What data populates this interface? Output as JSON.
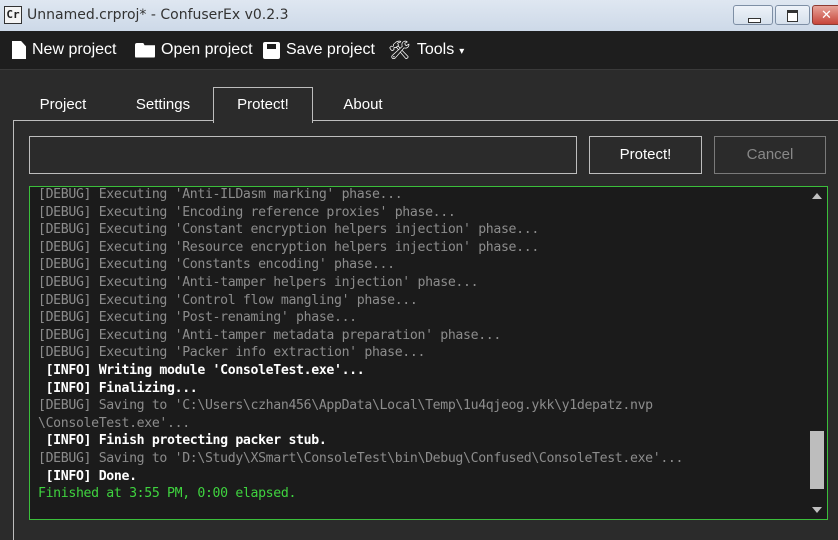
{
  "window": {
    "title": "Unnamed.crproj* - ConfuserEx v0.2.3",
    "icon_glyph": "Cr"
  },
  "toolbar": {
    "new_project": "New project",
    "open_project": "Open project",
    "save_project": "Save project",
    "tools": "Tools",
    "tools_caret": "▾"
  },
  "tabs": [
    {
      "label": "Project",
      "active": false
    },
    {
      "label": "Settings",
      "active": false
    },
    {
      "label": "Protect!",
      "active": true
    },
    {
      "label": "About",
      "active": false
    }
  ],
  "protect": {
    "input_value": "",
    "protect_button": "Protect!",
    "cancel_button": "Cancel",
    "cancel_enabled": false
  },
  "log": {
    "scroll_position": 0.95,
    "lines": [
      {
        "level": "debug",
        "text": "[DEBUG] Executing 'Anti-ILDasm marking' phase..."
      },
      {
        "level": "debug",
        "text": "[DEBUG] Executing 'Encoding reference proxies' phase..."
      },
      {
        "level": "debug",
        "text": "[DEBUG] Executing 'Constant encryption helpers injection' phase..."
      },
      {
        "level": "debug",
        "text": "[DEBUG] Executing 'Resource encryption helpers injection' phase..."
      },
      {
        "level": "debug",
        "text": "[DEBUG] Executing 'Constants encoding' phase..."
      },
      {
        "level": "debug",
        "text": "[DEBUG] Executing 'Anti-tamper helpers injection' phase..."
      },
      {
        "level": "debug",
        "text": "[DEBUG] Executing 'Control flow mangling' phase..."
      },
      {
        "level": "debug",
        "text": "[DEBUG] Executing 'Post-renaming' phase..."
      },
      {
        "level": "debug",
        "text": "[DEBUG] Executing 'Anti-tamper metadata preparation' phase..."
      },
      {
        "level": "debug",
        "text": "[DEBUG] Executing 'Packer info extraction' phase..."
      },
      {
        "level": "info",
        "text": " [INFO] Writing module 'ConsoleTest.exe'..."
      },
      {
        "level": "info",
        "text": " [INFO] Finalizing..."
      },
      {
        "level": "debug",
        "text": "[DEBUG] Saving to 'C:\\Users\\czhan456\\AppData\\Local\\Temp\\1u4qjeog.ykk\\y1depatz.nvp"
      },
      {
        "level": "debug",
        "text": "\\ConsoleTest.exe'..."
      },
      {
        "level": "info",
        "text": " [INFO] Finish protecting packer stub."
      },
      {
        "level": "debug",
        "text": "[DEBUG] Saving to 'D:\\Study\\XSmart\\ConsoleTest\\bin\\Debug\\Confused\\ConsoleTest.exe'..."
      },
      {
        "level": "info",
        "text": " [INFO] Done."
      },
      {
        "level": "success",
        "text": "Finished at 3:55 PM, 0:00 elapsed."
      }
    ]
  },
  "colors": {
    "background": "#2b2b2b",
    "toolbar": "#1e1e1e",
    "log_border": "#3bbf3b",
    "debug_text": "#8c8c8c",
    "info_text": "#ffffff",
    "success_text": "#3fd33f"
  }
}
